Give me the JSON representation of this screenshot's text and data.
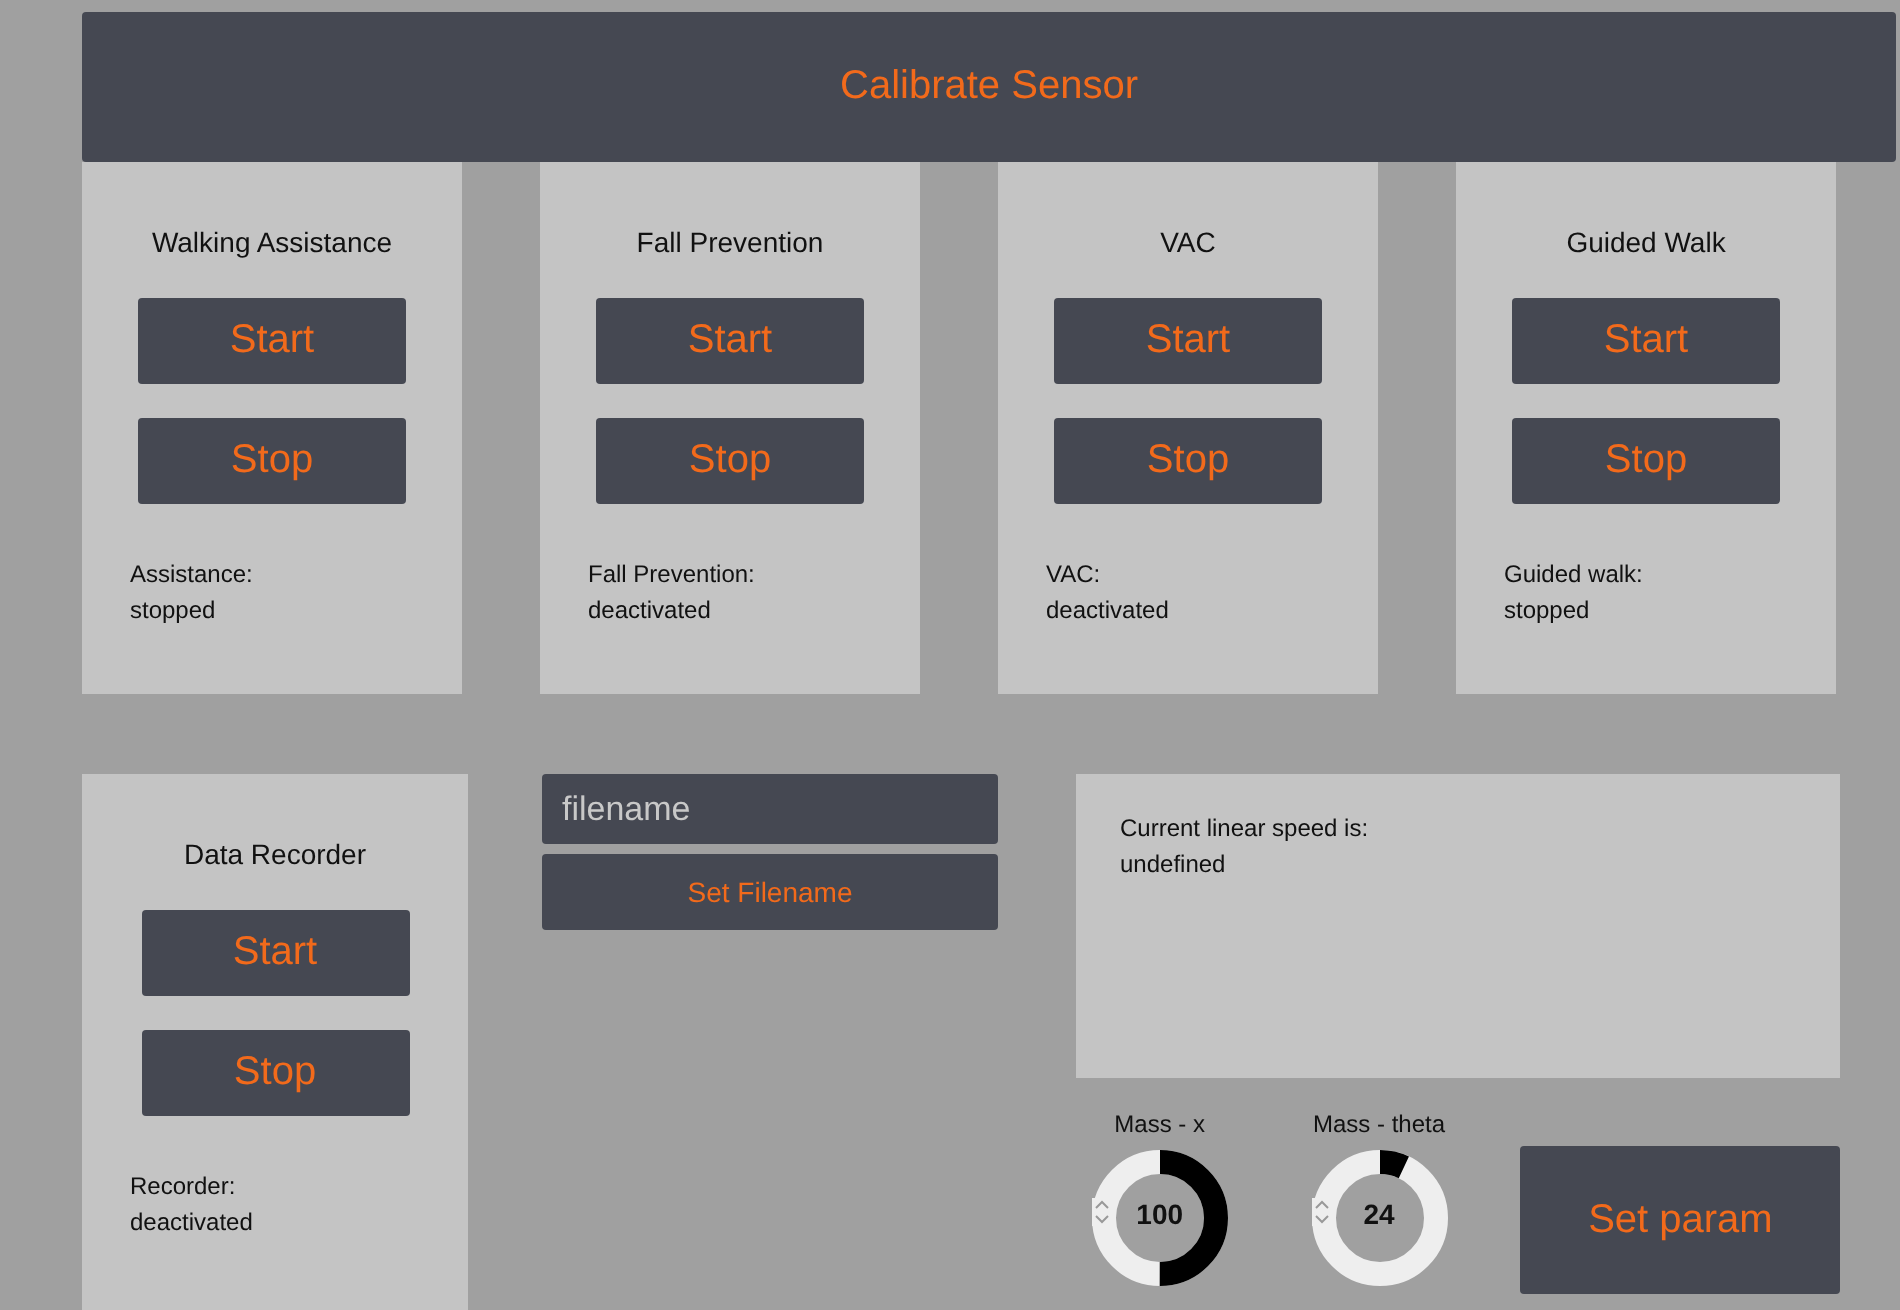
{
  "header": {
    "title": "Calibrate Sensor"
  },
  "modes": [
    {
      "title": "Walking Assistance",
      "start": "Start",
      "stop": "Stop",
      "status_label": "Assistance:",
      "status": "stopped"
    },
    {
      "title": "Fall Prevention",
      "start": "Start",
      "stop": "Stop",
      "status_label": "Fall Prevention:",
      "status": "deactivated"
    },
    {
      "title": "VAC",
      "start": "Start",
      "stop": "Stop",
      "status_label": "VAC:",
      "status": "deactivated"
    },
    {
      "title": "Guided Walk",
      "start": "Start",
      "stop": "Stop",
      "status_label": "Guided walk:",
      "status": "stopped"
    }
  ],
  "recorder": {
    "title": "Data Recorder",
    "start": "Start",
    "stop": "Stop",
    "status_label": "Recorder:",
    "status": "deactivated"
  },
  "filename": {
    "placeholder": "filename",
    "button": "Set Filename"
  },
  "speed": {
    "label": "Current linear speed is:",
    "value": "undefined"
  },
  "knobs": [
    {
      "label": "Mass - x",
      "value": "100",
      "level": 0.5
    },
    {
      "label": "Mass - theta",
      "value": "24",
      "level": 0.07
    }
  ],
  "set_param": "Set param"
}
